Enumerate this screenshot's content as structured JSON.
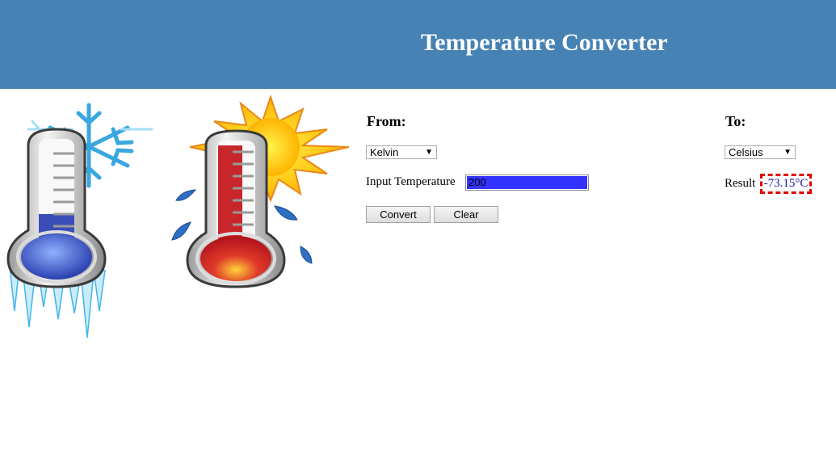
{
  "header": {
    "title": "Temperature Converter",
    "background": "#4682b4"
  },
  "illustration": {
    "left_icon": "cold-thermometer-icon",
    "right_icon": "hot-thermometer-icon"
  },
  "from": {
    "label": "From:",
    "selected": "Kelvin"
  },
  "to": {
    "label": "To:",
    "selected": "Celsius"
  },
  "input": {
    "label": "Input Temperature",
    "value": "200"
  },
  "buttons": {
    "convert": "Convert",
    "clear": "Clear"
  },
  "result": {
    "label": "Result",
    "value": "-73.15°C",
    "border_color": "#e00000"
  }
}
